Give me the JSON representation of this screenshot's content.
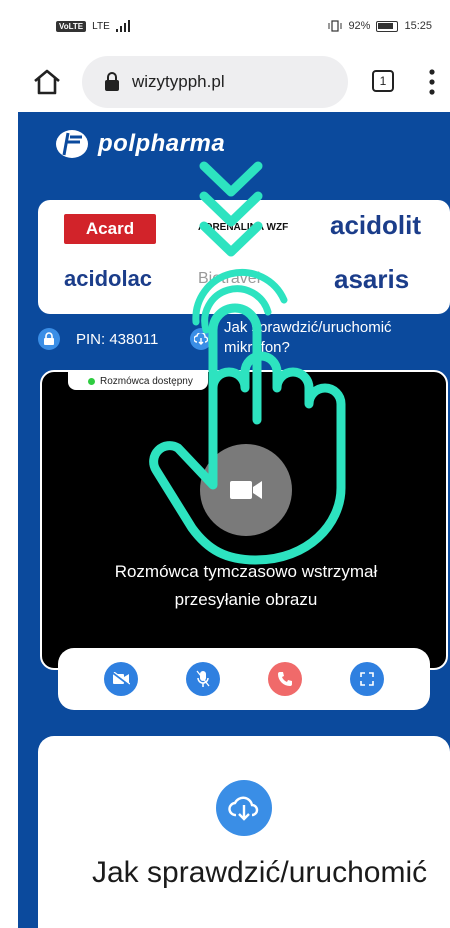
{
  "status_bar": {
    "network": "VoLTE",
    "lte": "LTE",
    "right": "92%",
    "time": "15:25"
  },
  "browser": {
    "url": "wizytypph.pl",
    "tab_count": "1"
  },
  "brand": {
    "logo_text": "polpharma"
  },
  "sponsors": {
    "acard": "Acard",
    "adrenalina": "ADRENALINA WZF",
    "acidolit": "acidolit",
    "acidolac": "acidolac",
    "biotrav": "Biotravel",
    "asaris": "asaris"
  },
  "call": {
    "pin": "PIN: 438011",
    "help": "Jak sprawdzić/uruchomić mikrofon?",
    "status": "Rozmówca dostępny",
    "paused_line1": "Rozmówca tymczasowo wstrzymał",
    "paused_line2": "przesyłanie obrazu"
  },
  "card": {
    "title": "Jak sprawdzić/uruchomić"
  },
  "colors": {
    "page_blue": "#0b4a9d",
    "button_blue": "#2f80e0",
    "hangup_red": "#f06a6a",
    "hand_overlay": "#2de3c0"
  }
}
